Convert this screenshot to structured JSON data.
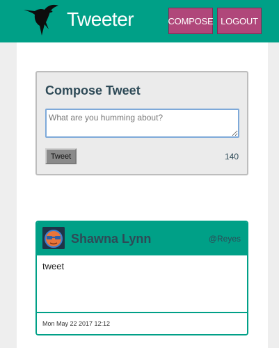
{
  "header": {
    "brand": "Tweeter",
    "logo_icon": "hummingbird-icon",
    "compose_label": "COMPOSE",
    "logout_label": "LOGOUT",
    "accent_color": "#00a087",
    "button_color": "#b0477a"
  },
  "compose": {
    "title": "Compose Tweet",
    "placeholder": "What are you humming about?",
    "value": "",
    "button_label": "Tweet",
    "counter": "140"
  },
  "tweets": [
    {
      "name": "Shawna Lynn",
      "handle": "@Reyes",
      "avatar_icon": "avatar-icon",
      "body": "tweet",
      "timestamp": "Mon May 22 2017 12:12"
    }
  ]
}
